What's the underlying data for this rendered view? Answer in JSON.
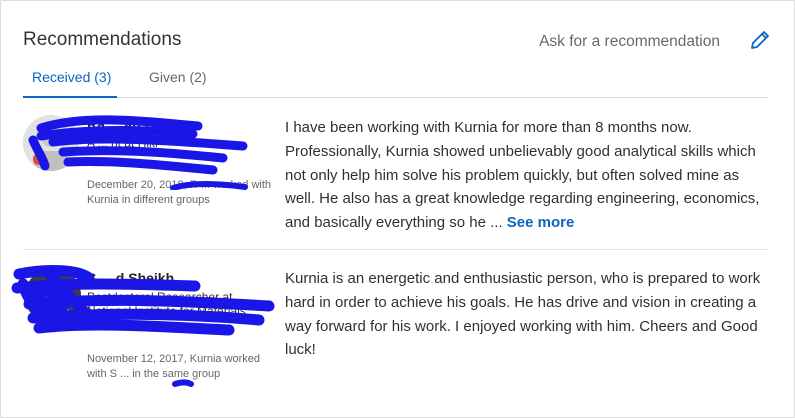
{
  "header": {
    "title": "Recommendations",
    "ask_label": "Ask for a recommendation"
  },
  "tabs": [
    {
      "label": "Received (3)",
      "active": true
    },
    {
      "label": "Given (2)",
      "active": false
    }
  ],
  "recommendations": [
    {
      "name": "Ra ... ah Putra",
      "headline": "A ... nt at Hiki",
      "meta": "December 20, 2018, R ... worked with Kurnia in different groups",
      "text": "I have been working with Kurnia for more than 8 months now. Professionally, Kurnia showed unbelievably good analytical skills which not only help him solve his problem quickly, but often solved mine as well. He also has a great knowledge regarding engineering, economics, and basically everything so he ...",
      "see_more": "See more"
    },
    {
      "name": "S ... d Sheikh",
      "headline": "Postdoctoral Researcher at National Institute for Materials Science",
      "meta": "November 12, 2017, Kurnia worked with S ... in the same group",
      "text": "Kurnia is an energetic and enthusiastic person, who is prepared to work hard in order to achieve his goals. He has drive and vision in creating a way forward for his work. I enjoyed working with him. Cheers and Good luck!"
    }
  ],
  "colors": {
    "accent": "#0a66c2",
    "redaction": "#1a16e6"
  }
}
